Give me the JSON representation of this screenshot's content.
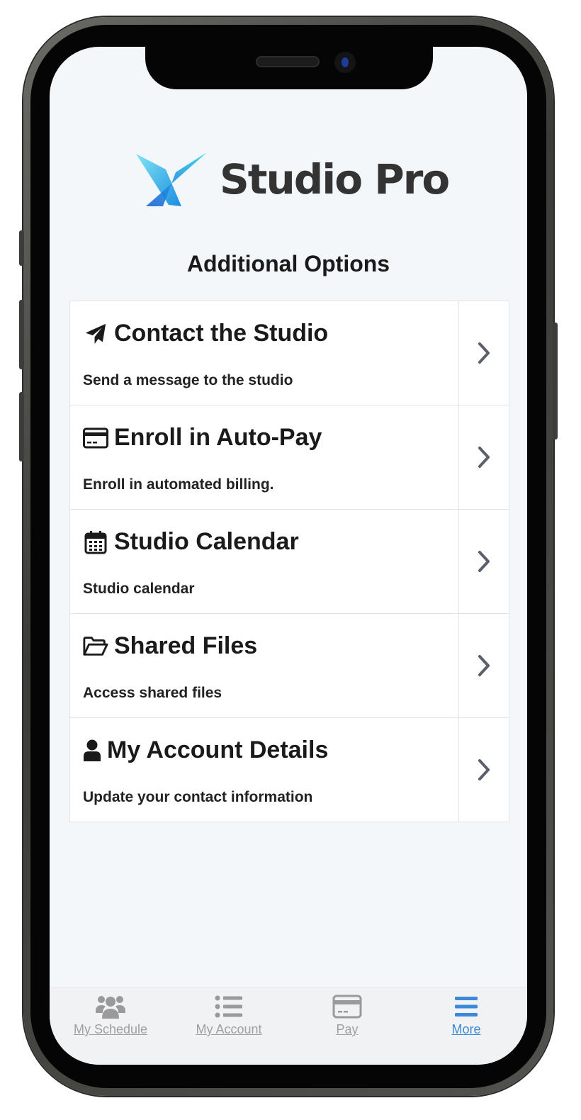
{
  "brand": {
    "name": "Studio Pro",
    "accent": "#2bb6ec"
  },
  "page": {
    "title": "Additional Options"
  },
  "options": [
    {
      "icon": "paper-plane-icon",
      "title": "Contact the Studio",
      "description": "Send a message to the studio"
    },
    {
      "icon": "credit-card-icon",
      "title": "Enroll in Auto-Pay",
      "description": "Enroll in automated billing."
    },
    {
      "icon": "calendar-icon",
      "title": "Studio Calendar",
      "description": "Studio calendar"
    },
    {
      "icon": "folder-open-icon",
      "title": "Shared Files",
      "description": "Access shared files"
    },
    {
      "icon": "user-icon",
      "title": "My Account Details",
      "description": "Update your contact information"
    }
  ],
  "tabs": [
    {
      "label": "My Schedule",
      "icon": "users-icon",
      "active": false
    },
    {
      "label": "My Account",
      "icon": "list-icon",
      "active": false
    },
    {
      "label": "Pay",
      "icon": "credit-card-icon",
      "active": false
    },
    {
      "label": "More",
      "icon": "menu-icon",
      "active": true
    }
  ],
  "colors": {
    "active_tab": "#3c88d8",
    "inactive_tab": "#a0a0a0",
    "chevron": "#5a5f6b"
  }
}
